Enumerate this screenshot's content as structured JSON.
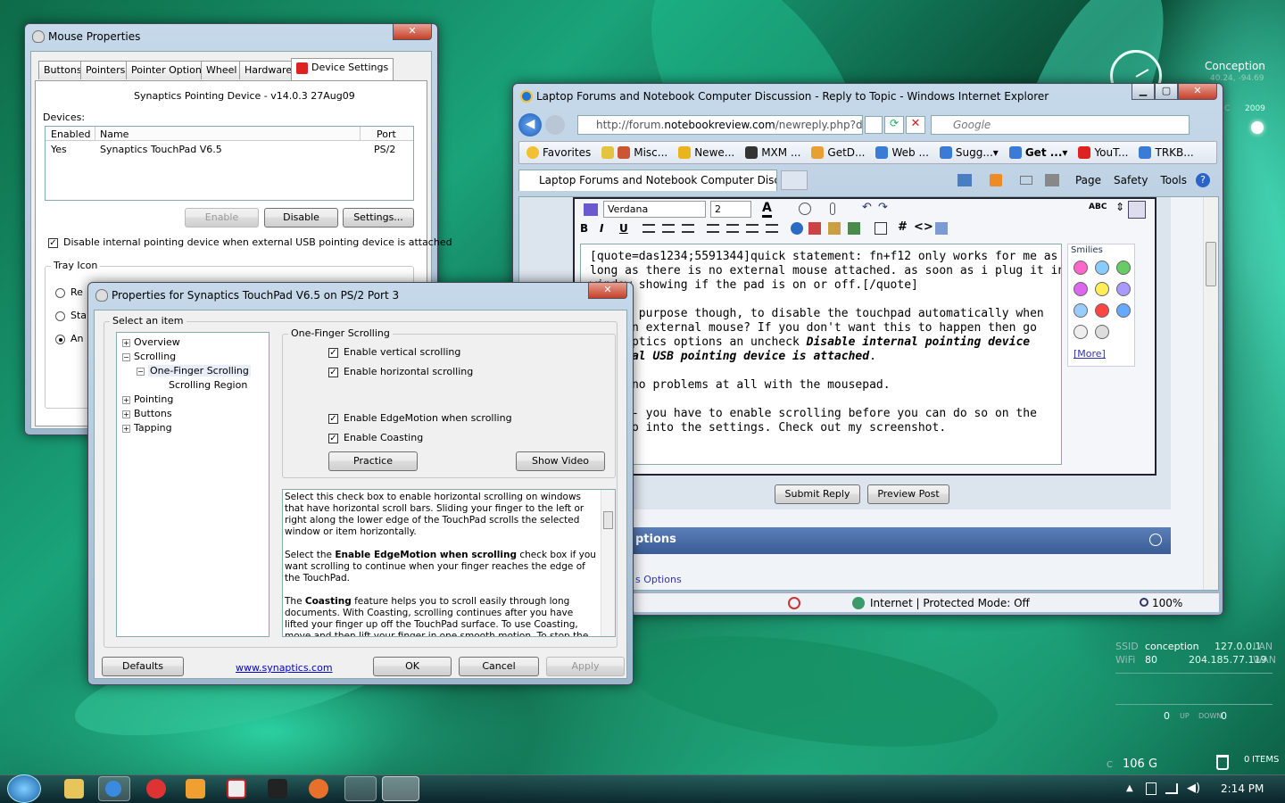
{
  "desktop": {
    "gadget_clock": {
      "title": "Conception",
      "sub1": "40.24, -94.69",
      "sub2": "C",
      "year": "2009"
    },
    "gadget_network": {
      "ssid_label": "SSID",
      "wifi_label": "WiFi",
      "name": "conception",
      "ip": "127.0.0.1",
      "lan": "LAN",
      "signal": "80",
      "ext_ip": "204.185.77.119",
      "wan": "WAN",
      "up_value": "0",
      "up_label": "UP",
      "down_label": "DOWN",
      "down_value": "0"
    },
    "gadget_drive": {
      "drive": "C",
      "size": "106 G"
    },
    "gadget_recycle": {
      "count": "0",
      "label": "ITEMS"
    }
  },
  "taskbar": {
    "clock": "2:14 PM"
  },
  "mouse_props": {
    "title": "Mouse Properties",
    "tabs": [
      "Buttons",
      "Pointers",
      "Pointer Options",
      "Wheel",
      "Hardware",
      "Device Settings"
    ],
    "device_line": "Synaptics Pointing Device - v14.0.3 27Aug09",
    "devices_label": "Devices:",
    "columns": [
      "Enabled",
      "Name",
      "Port"
    ],
    "row": {
      "enabled": "Yes",
      "name": "Synaptics TouchPad V6.5",
      "port": "PS/2"
    },
    "enable_btn": "Enable",
    "disable_btn": "Disable",
    "settings_btn": "Settings...",
    "disable_internal": "Disable internal pointing device when external USB pointing device is attached",
    "tray_icon": "Tray Icon",
    "radios": [
      "Re",
      "Sta",
      "An"
    ]
  },
  "synaptics": {
    "title": "Properties for Synaptics TouchPad V6.5 on PS/2 Port 3",
    "select_item": "Select an item",
    "tree": [
      "Overview",
      "Scrolling",
      "One-Finger Scrolling",
      "Scrolling Region",
      "Pointing",
      "Buttons",
      "Tapping"
    ],
    "group_title": "One-Finger Scrolling",
    "opt1": "Enable vertical scrolling",
    "opt2": "Enable horizontal scrolling",
    "opt3": "Enable EdgeMotion when scrolling",
    "opt4": "Enable Coasting",
    "practice": "Practice",
    "show_video": "Show Video",
    "help_p1": "Select this check box to enable horizontal scrolling on windows that have horizontal scroll bars. Sliding your finger to the left or right along the lower edge of the TouchPad scrolls the selected window or item horizontally.",
    "help_p2a": "Select the ",
    "help_p2b": "Enable EdgeMotion when scrolling",
    "help_p2c": " check box if you want scrolling to continue when your finger reaches the edge of the TouchPad.",
    "help_p3a": "The ",
    "help_p3b": "Coasting",
    "help_p3c": " feature helps you to scroll easily through long documents. With Coasting, scrolling continues after you have lifted your finger up off the TouchPad surface. To use Coasting, move and then lift your finger in one smooth motion. To stop the coasting motion, place your finger back",
    "defaults": "Defaults",
    "link": "www.synaptics.com",
    "ok": "OK",
    "cancel": "Cancel",
    "apply": "Apply"
  },
  "ie": {
    "title": "Laptop Forums and Notebook Computer Discussion - Reply to Topic - Windows Internet Explorer",
    "url_plain": "http://forum.",
    "url_bold": "notebookreview.com",
    "url_rest": "/newreply.php?dc",
    "search_placeholder": "Google",
    "favorites": "Favorites",
    "fav_items": [
      "Misc...",
      "Newe...",
      "MXM ...",
      "GetD...",
      "Web ...",
      "Sugg...",
      "Get ...",
      "YouT...",
      "TRKB..."
    ],
    "tab_title": "Laptop Forums and Notebook Computer Discuss...",
    "cmd_page": "Page",
    "cmd_safety": "Safety",
    "cmd_tools": "Tools",
    "font_name": "Verdana",
    "font_size": "2",
    "editor_l1": "[quote=das1234;5591344]quick statement: fn+f12 only works for me as",
    "editor_l2": "long as there is no external mouse attached. as soon as i plug it in i get a",
    "editor_l3": "window showing if the pad is on or off.[/quote]",
    "editor_l4": "is the purpose though, to disable the touchpad automatically when",
    "editor_l5": "g in an external mouse?  If you don't want this to happen then go",
    "editor_l6a": "e synaptics options an uncheck ",
    "editor_l6b": "Disable internal pointing device",
    "editor_l7b": "external USB pointing device is attached",
    "editor_l7c": ".",
    "editor_l8": "aving no problems at all with the mousepad.",
    "editor_l9": "nu03 -- you have to enable scrolling before you can do so on the",
    "editor_l10": "pad. Go into the settings. Check out my screenshot.",
    "smilies": "Smilies",
    "more": "[More]",
    "submit": "Submit Reply",
    "preview": "Preview Post",
    "options": "ptions",
    "options_sub": "s Options",
    "status": "Internet | Protected Mode: Off",
    "zoom": "100%"
  }
}
